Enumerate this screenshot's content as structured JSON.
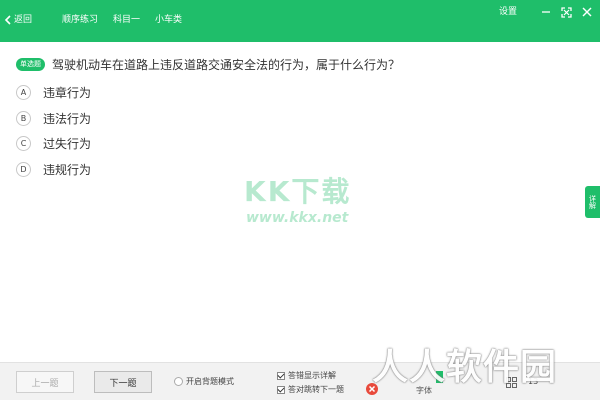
{
  "topbar": {
    "back_label": "返回",
    "nav_items": [
      "顺序练习",
      "科目一",
      "小车类"
    ],
    "settings_label": "设置"
  },
  "question": {
    "type_badge": "单选题",
    "text": "驾驶机动车在道路上违反道路交通安全法的行为，属于什么行为？",
    "options": [
      {
        "letter": "A",
        "text": "违章行为"
      },
      {
        "letter": "B",
        "text": "违法行为"
      },
      {
        "letter": "C",
        "text": "过失行为"
      },
      {
        "letter": "D",
        "text": "违规行为"
      }
    ]
  },
  "side_tab": {
    "label": "详解"
  },
  "watermark": {
    "big": "KK下载",
    "small": "www.kkx.net"
  },
  "bottombar": {
    "prev_label": "上一题",
    "next_label": "下一题",
    "recite_label": "开启背题模式",
    "checkbox1_label": "答错显示详解",
    "checkbox2_label": "答对跳转下一题",
    "right_label": "字体",
    "count": "13"
  },
  "corner_watermark": "人人软件园",
  "colors": {
    "accent": "#1fbe6a",
    "wrong": "#e84a3c"
  }
}
